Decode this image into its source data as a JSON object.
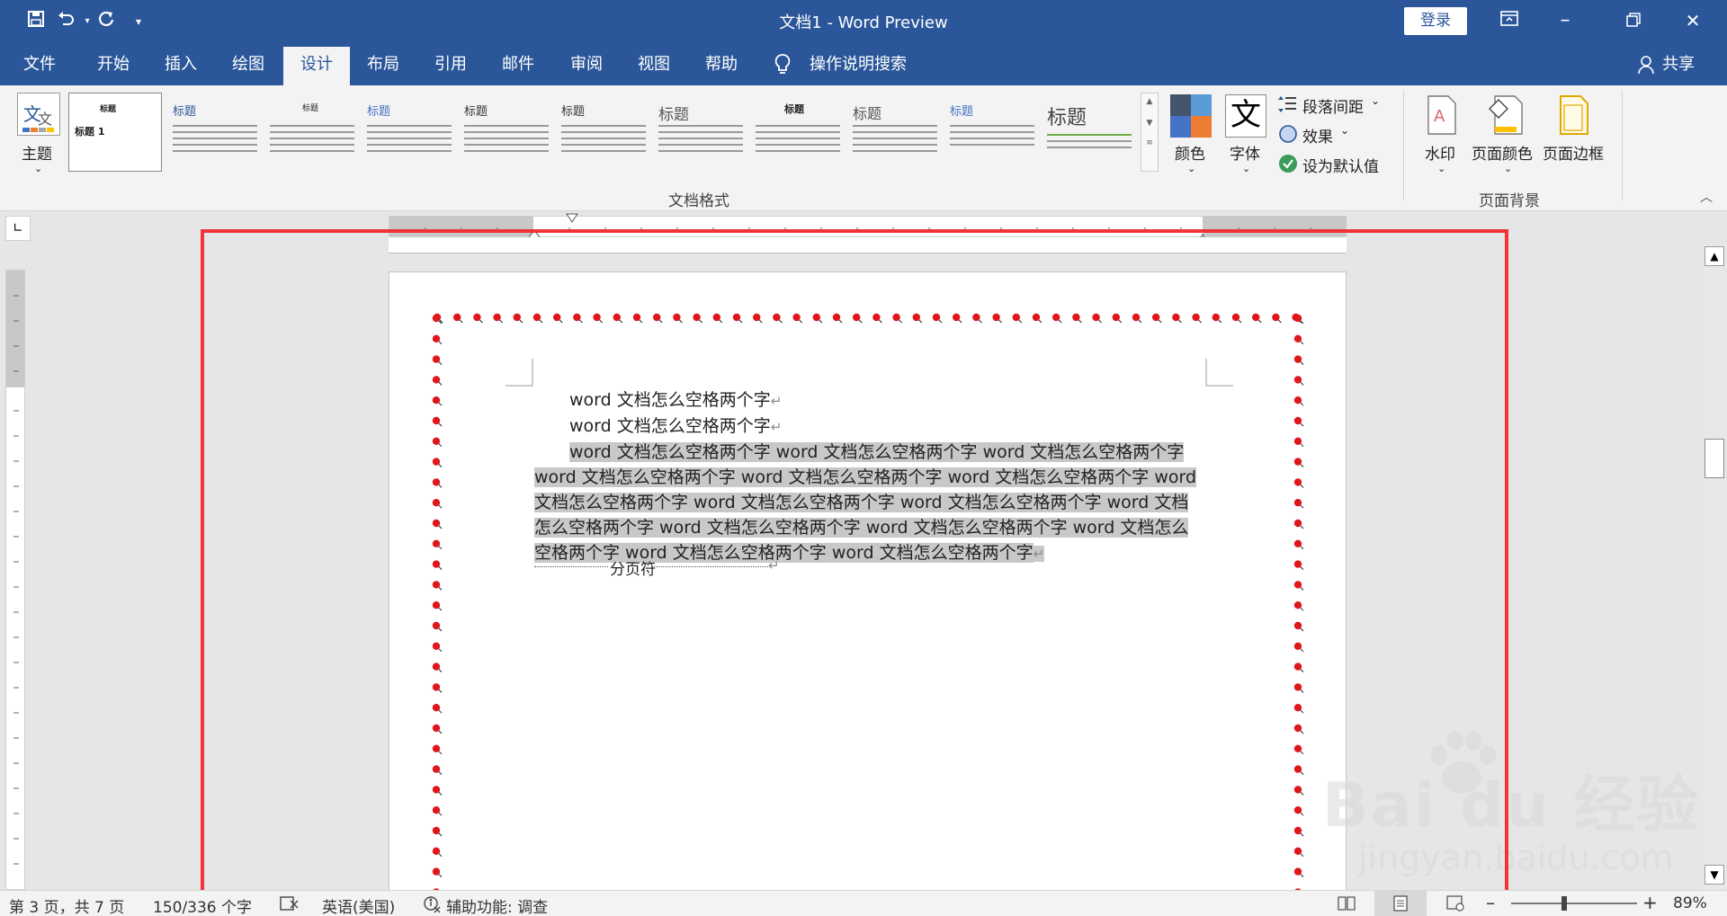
{
  "titlebar": {
    "title": "文档1  -  Word Preview",
    "login_label": "登录",
    "quick_access": [
      "save-icon",
      "undo-icon",
      "redo-icon",
      "customize-icon"
    ]
  },
  "menu": {
    "tabs": [
      "文件",
      "开始",
      "插入",
      "绘图",
      "设计",
      "布局",
      "引用",
      "邮件",
      "审阅",
      "视图",
      "帮助"
    ],
    "active_tab": "设计",
    "tell_me": "操作说明搜索",
    "share": "共享"
  },
  "ribbon": {
    "theme_label": "主题",
    "gallery_heading": "标题",
    "gallery_first_sub": "标题 1",
    "group_document_format": "文档格式",
    "colors_label": "颜色",
    "fonts_label": "字体",
    "paragraph_spacing": "段落间距",
    "effects": "效果",
    "set_default": "设为默认值",
    "watermark": "水印",
    "page_color": "页面颜色",
    "page_borders": "页面边框",
    "group_page_background": "页面背景",
    "font_icon_glyph": "文"
  },
  "document": {
    "line1": "word 文档怎么空格两个字",
    "line2": "word 文档怎么空格两个字",
    "para": [
      "word 文档怎么空格两个字 word 文档怎么空格两个字 word 文档怎么空格两个字",
      "word 文档怎么空格两个字 word 文档怎么空格两个字 word 文档怎么空格两个字 word",
      "文档怎么空格两个字 word 文档怎么空格两个字 word 文档怎么空格两个字 word 文档",
      "怎么空格两个字 word 文档怎么空格两个字 word 文档怎么空格两个字 word 文档怎么",
      "空格两个字 word 文档怎么空格两个字 word 文档怎么空格两个字"
    ],
    "para_mark": "↵",
    "page_break_label": "分页符"
  },
  "statusbar": {
    "page_info": "第 3 页，共 7 页",
    "word_count": "150/336 个字",
    "language": "英语(美国)",
    "accessibility": "辅助功能: 调查",
    "zoom": "89%"
  },
  "watermark": {
    "brand": "Bai du 经验",
    "url": "jingyan.baidu.com"
  },
  "colors": {
    "accent": "#2b579a",
    "annotation_red": "#f0343a",
    "art_border_red": "#e0161d"
  }
}
